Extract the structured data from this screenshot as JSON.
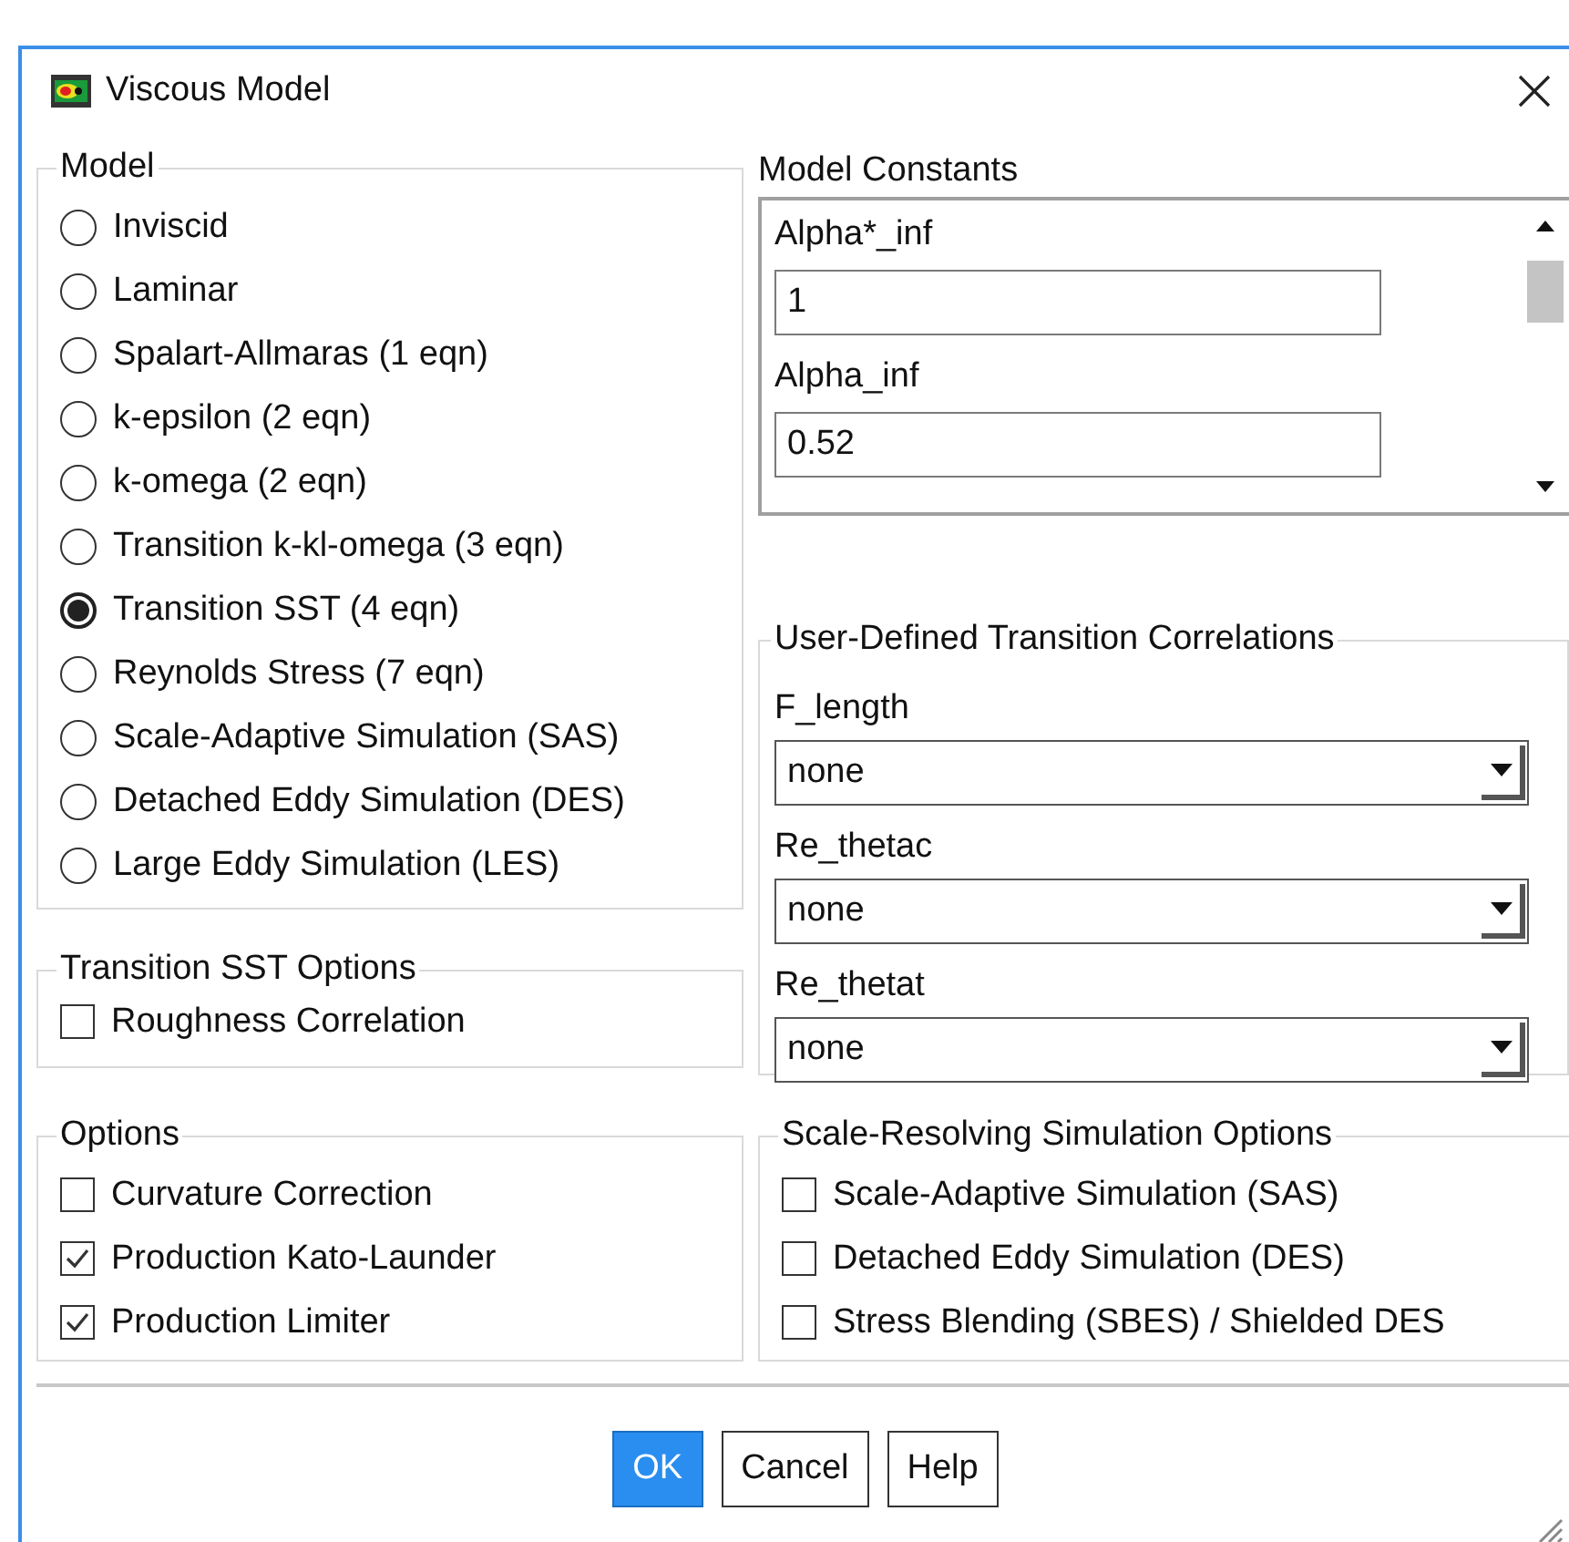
{
  "window": {
    "title": "Viscous Model"
  },
  "model": {
    "label": "Model",
    "options": [
      {
        "label": "Inviscid",
        "selected": false
      },
      {
        "label": "Laminar",
        "selected": false
      },
      {
        "label": "Spalart-Allmaras (1 eqn)",
        "selected": false
      },
      {
        "label": "k-epsilon (2 eqn)",
        "selected": false
      },
      {
        "label": "k-omega (2 eqn)",
        "selected": false
      },
      {
        "label": "Transition k-kl-omega (3 eqn)",
        "selected": false
      },
      {
        "label": "Transition SST (4 eqn)",
        "selected": true
      },
      {
        "label": "Reynolds Stress (7 eqn)",
        "selected": false
      },
      {
        "label": "Scale-Adaptive Simulation (SAS)",
        "selected": false
      },
      {
        "label": "Detached Eddy Simulation (DES)",
        "selected": false
      },
      {
        "label": "Large Eddy Simulation (LES)",
        "selected": false
      }
    ]
  },
  "transition_sst_options": {
    "label": "Transition SST Options",
    "checkboxes": [
      {
        "label": "Roughness Correlation",
        "checked": false
      }
    ]
  },
  "options": {
    "label": "Options",
    "checkboxes": [
      {
        "label": "Curvature Correction",
        "checked": false
      },
      {
        "label": "Production Kato-Launder",
        "checked": true
      },
      {
        "label": "Production Limiter",
        "checked": true
      }
    ]
  },
  "model_constants": {
    "label": "Model Constants",
    "fields": [
      {
        "label": "Alpha*_inf",
        "value": "1"
      },
      {
        "label": "Alpha_inf",
        "value": "0.52"
      }
    ]
  },
  "correlations": {
    "label": "User-Defined Transition Correlations",
    "dropdowns": [
      {
        "label": "F_length",
        "value": "none"
      },
      {
        "label": "Re_thetac",
        "value": "none"
      },
      {
        "label": "Re_thetat",
        "value": "none"
      }
    ]
  },
  "scale_resolving_options": {
    "label": "Scale-Resolving Simulation Options",
    "checkboxes": [
      {
        "label": "Scale-Adaptive Simulation (SAS)",
        "checked": false
      },
      {
        "label": "Detached Eddy Simulation (DES)",
        "checked": false
      },
      {
        "label": "Stress Blending (SBES) / Shielded DES",
        "checked": false
      }
    ]
  },
  "buttons": [
    {
      "label": "OK",
      "default": true
    },
    {
      "label": "Cancel",
      "default": false
    },
    {
      "label": "Help",
      "default": false
    }
  ]
}
